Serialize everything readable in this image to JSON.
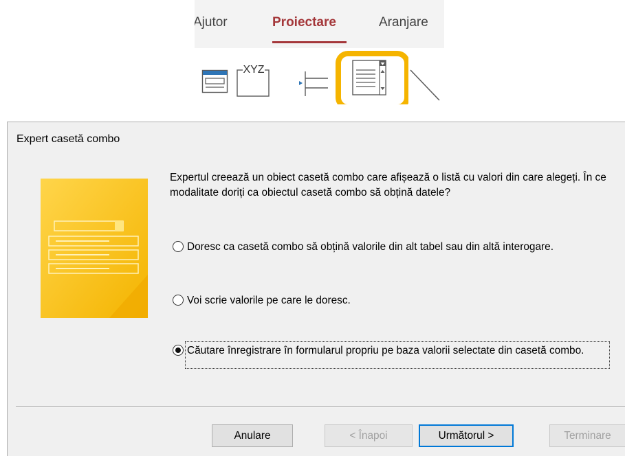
{
  "ribbon": {
    "tabs": [
      {
        "label": "Ajutor",
        "active": false
      },
      {
        "label": "Proiectare",
        "active": true
      },
      {
        "label": "Aranjare",
        "active": false
      }
    ],
    "controls": [
      {
        "name": "form-icon"
      },
      {
        "name": "label-icon",
        "text": "XYZ"
      },
      {
        "name": "page-break-icon"
      },
      {
        "name": "combo-box-icon",
        "highlighted": true,
        "highlight_color": "#f5b400"
      },
      {
        "name": "line-icon"
      }
    ],
    "accent_color": "#a4373a"
  },
  "dialog": {
    "title": "Expert casetă combo",
    "description": "Expertul creează un obiect casetă combo care afișează o listă cu valori din care alegeți. În ce modalitate doriți ca obiectul casetă combo să obțină datele?",
    "options": [
      {
        "label": "Doresc ca casetă combo să obțină valorile din alt tabel sau din altă interogare.",
        "checked": false
      },
      {
        "label": "Voi scrie valorile pe care le doresc.",
        "checked": false
      },
      {
        "label": "Căutare înregistrare în formularul propriu pe baza valorii selectate din casetă combo.",
        "checked": true
      }
    ],
    "buttons": [
      {
        "label": "Anulare",
        "enabled": true
      },
      {
        "label": "< Înapoi",
        "enabled": false
      },
      {
        "label": "Următorul >",
        "enabled": true,
        "default": true
      },
      {
        "label": "Terminare",
        "enabled": false
      }
    ]
  }
}
